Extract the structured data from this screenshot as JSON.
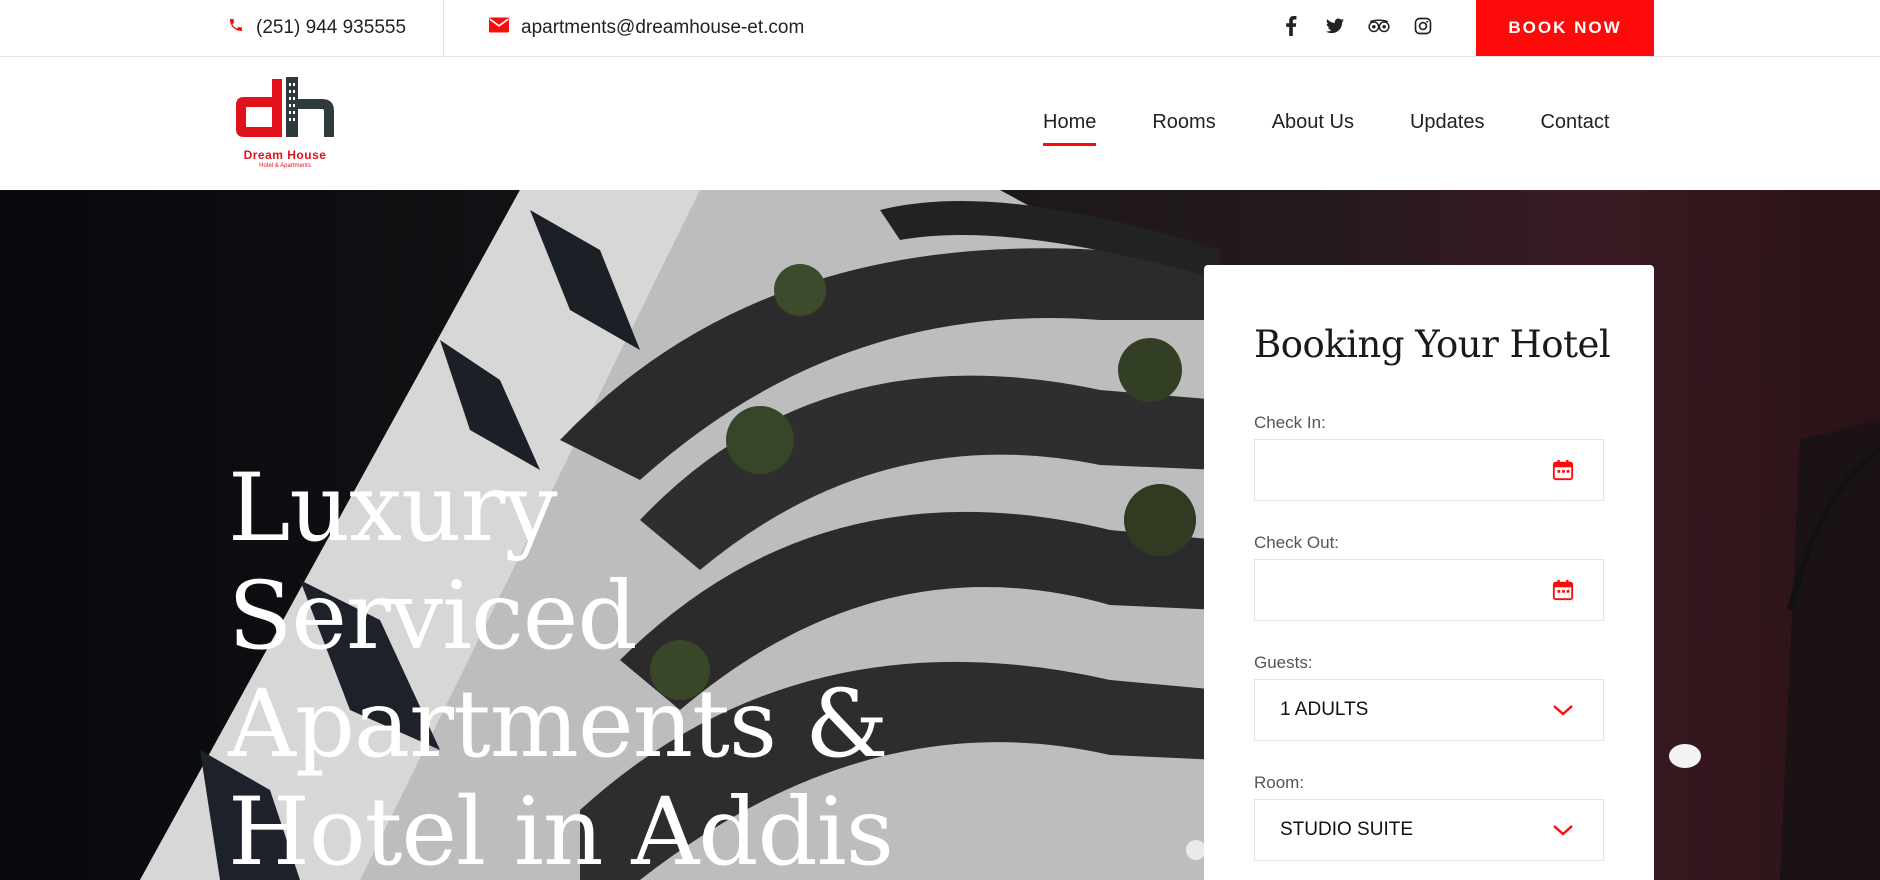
{
  "topbar": {
    "phone": "(251) 944 935555",
    "email": "apartments@dreamhouse-et.com",
    "social": [
      "facebook-icon",
      "twitter-icon",
      "tripadvisor-icon",
      "instagram-icon"
    ],
    "book_now": "BOOK NOW"
  },
  "brand": {
    "name": "Dream House",
    "tagline": "Hotel & Apartments"
  },
  "nav": {
    "items": [
      "Home",
      "Rooms",
      "About Us",
      "Updates",
      "Contact"
    ],
    "active": "Home"
  },
  "hero": {
    "title_lines": [
      "Luxury",
      "Serviced",
      "Apartments &",
      "Hotel in Addis"
    ]
  },
  "booking": {
    "title": "Booking Your Hotel",
    "check_in_label": "Check In:",
    "check_in_value": "",
    "check_out_label": "Check Out:",
    "check_out_value": "",
    "guests_label": "Guests:",
    "guests_value": "1 ADULTS",
    "room_label": "Room:",
    "room_value": "STUDIO SUITE"
  },
  "colors": {
    "accent": "#ff0a0a",
    "brand_dark": "#2f3a3d"
  }
}
